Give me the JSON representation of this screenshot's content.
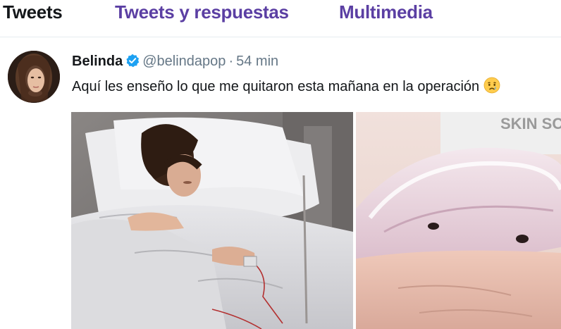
{
  "tabs": [
    {
      "label": "Tweets"
    },
    {
      "label": "Tweets y respuestas"
    },
    {
      "label": "Multimedia"
    }
  ],
  "tweet": {
    "display_name": "Belinda",
    "verified": true,
    "handle": "@belindapop",
    "separator": "·",
    "time": "54 min",
    "text": "Aquí les enseño lo que me quitaron esta mañana en la operación",
    "emoji": "crying-face",
    "images": [
      {
        "description_name": "hospital-bed-photo"
      },
      {
        "description_name": "implant-closeup-photo"
      }
    ],
    "image2_printed_text": "SKIN SC"
  },
  "colors": {
    "active_tab": "#14171a",
    "inactive_tab": "#5b3fa3",
    "verified": "#1da1f2",
    "secondary_text": "#657786"
  }
}
